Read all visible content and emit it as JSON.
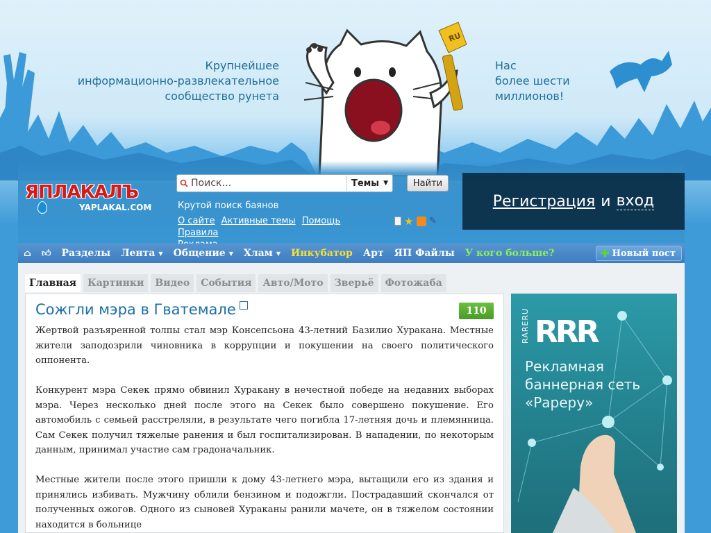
{
  "hero": {
    "tagline_left": [
      "Крупнейшее",
      "информационно-развлекательное",
      "сообщество рунета"
    ],
    "tagline_right": [
      "Нас",
      "более шести",
      "миллионов!"
    ],
    "trophy_label": "RU"
  },
  "logo": {
    "main": "ЯПЛАКАЛЪ",
    "sub": "YAPLAKAL.COM"
  },
  "search": {
    "placeholder": "Поиск…",
    "scope": "Темы",
    "button": "Найти",
    "hint": "Крутой поиск баянов"
  },
  "header_links": [
    "О сайте",
    "Активные темы",
    "Помощь",
    "Правила",
    "Реклама"
  ],
  "auth": {
    "register": "Регистрация",
    "and": "и",
    "login": "вход"
  },
  "nav": {
    "items": [
      {
        "label": "Разделы",
        "caret": false,
        "style": ""
      },
      {
        "label": "Лента",
        "caret": true,
        "style": ""
      },
      {
        "label": "Общение",
        "caret": true,
        "style": ""
      },
      {
        "label": "Хлам",
        "caret": true,
        "style": ""
      },
      {
        "label": "Инкубатор",
        "caret": false,
        "style": "yellow"
      },
      {
        "label": "Арт",
        "caret": false,
        "style": ""
      },
      {
        "label": "ЯП Файлы",
        "caret": false,
        "style": ""
      },
      {
        "label": "У кого больше?",
        "caret": false,
        "style": "green"
      }
    ],
    "new_post": "Новый пост"
  },
  "tabs": [
    "Главная",
    "Картинки",
    "Видео",
    "События",
    "Авто/Мото",
    "Зверьё",
    "Фотожаба"
  ],
  "active_tab": "Главная",
  "post": {
    "title": "Сожгли мэра в Гватемале",
    "rating": "110",
    "paragraphs": [
      "Жертвой разъяренной толпы стал мэр Консепсьона 43-летний Базилио Хуракана. Местные жители заподозрили чиновника в коррупции и покушении на своего политического оппонента.",
      "Конкурент мэра Секек прямо обвинил Хуракану в нечестной победе на недавних выборах мэра. Через несколько дней после этого на Секек было совершено покушение. Его автомобиль с семьей расстреляли, в результате чего погибла 17-летняя дочь и племянница. Сам Секек получил тяжелые ранения и был госпитализирован. В нападении, по некоторым данным, принимал участие сам градоначальник.",
      "Местные жители после этого пришли к дому 43-летнего мэра, вытащили его из здания и принялись избивать. Мужчину облили бензином и подожгли. Пострадавший скончался от полученных ожогов. Одного из сыновей Хураканы ранили мачете, он в тяжелом состоянии находится в больнице"
    ]
  },
  "ad": {
    "vertical": "RARERU",
    "logo": "RRR",
    "text": "Рекламная баннерная сеть «Рареру»"
  },
  "colors": {
    "accent_blue": "#1a6ea6",
    "nav_blue": "#3d7dc0",
    "rating_green": "#4a9a28",
    "logo_red": "#d61a1a"
  }
}
